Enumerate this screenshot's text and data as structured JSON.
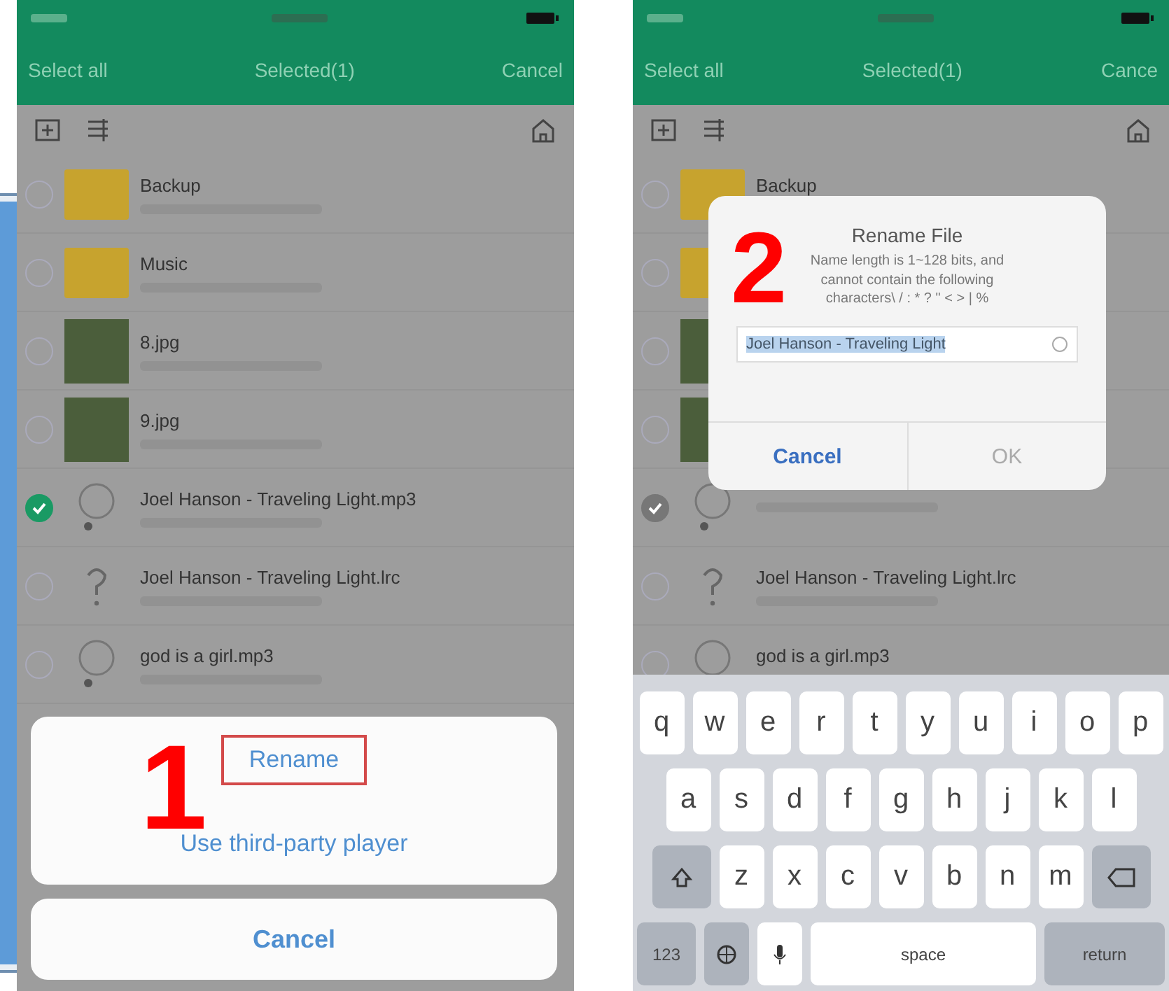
{
  "phones": [
    {
      "kind": "action_sheet",
      "header": {
        "left": "Select all",
        "title": "Selected(1)",
        "right": "Cancel"
      },
      "files": [
        {
          "kind": "folder",
          "name": "Backup",
          "checked": false
        },
        {
          "kind": "folder",
          "name": "Music",
          "checked": false
        },
        {
          "kind": "image",
          "name": "8.jpg",
          "checked": false
        },
        {
          "kind": "image",
          "name": "9.jpg",
          "checked": false
        },
        {
          "kind": "audio",
          "name": "Joel Hanson - Traveling Light.mp3",
          "checked": true
        },
        {
          "kind": "unknown",
          "name": "Joel Hanson - Traveling Light.lrc",
          "checked": false
        },
        {
          "kind": "audio",
          "name": "god is a girl.mp3",
          "checked": false
        }
      ],
      "sheet": {
        "actions": [
          {
            "label": "Rename",
            "highlighted": true
          },
          {
            "label": "Use third-party player",
            "highlighted": false
          }
        ],
        "cancel": "Cancel"
      },
      "step": "1"
    },
    {
      "kind": "rename_dialog",
      "header": {
        "left": "Select all",
        "title": "Selected(1)",
        "right": "Cance"
      },
      "files": [
        {
          "kind": "folder",
          "name": "Backup",
          "checked": false
        },
        {
          "kind": "folder",
          "checked": false
        },
        {
          "kind": "image",
          "checked": false
        },
        {
          "kind": "image",
          "checked": false
        },
        {
          "kind": "audio",
          "checked": true
        },
        {
          "kind": "unknown",
          "name": "Joel Hanson - Traveling Light.lrc",
          "checked": false
        },
        {
          "kind": "audio",
          "name": "god is a girl.mp3",
          "checked": false
        }
      ],
      "dialog": {
        "title": "Rename File",
        "message": "Name length is 1~128 bits, and cannot contain the following characters\\ / : * ? \" < > | %",
        "value": "Joel Hanson - Traveling Light",
        "cancel": "Cancel",
        "ok": "OK"
      },
      "keyboard": {
        "rows": [
          [
            "q",
            "w",
            "e",
            "r",
            "t",
            "y",
            "u",
            "i",
            "o",
            "p"
          ],
          [
            "a",
            "s",
            "d",
            "f",
            "g",
            "h",
            "j",
            "k",
            "l"
          ],
          [
            "z",
            "x",
            "c",
            "v",
            "b",
            "n",
            "m"
          ]
        ],
        "numbers": "123",
        "space": "space",
        "return": "return"
      },
      "step": "2"
    }
  ]
}
